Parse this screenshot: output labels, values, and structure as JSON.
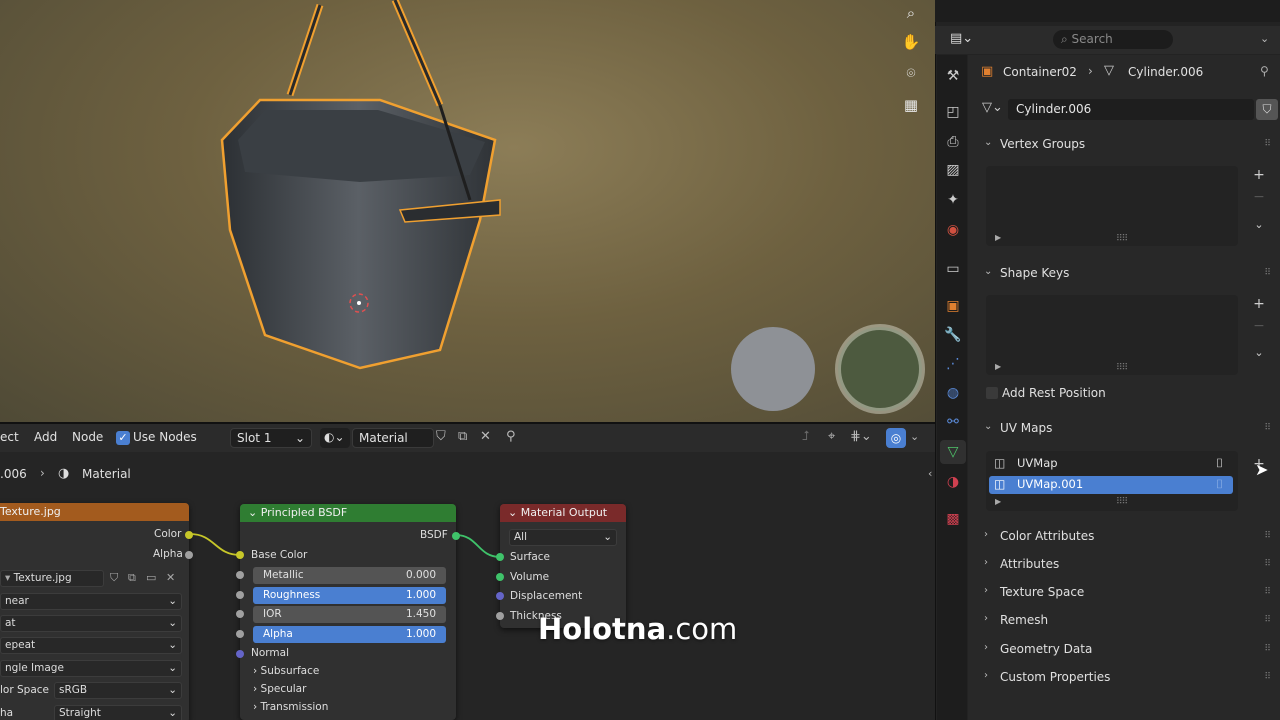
{
  "viewport": {
    "nav_icons": [
      "zoom-icon",
      "hand-pan-icon",
      "camera-icon",
      "grid-ortho-icon"
    ]
  },
  "node_header": {
    "menu_items": [
      "ect",
      "Add",
      "Node"
    ],
    "use_nodes_label": "Use Nodes",
    "use_nodes_checked": true,
    "slot": "Slot 1",
    "material_name": "Material",
    "breadcrumb_object": ".006",
    "breadcrumb_material": "Material"
  },
  "texture_node": {
    "title": "Texture.jpg",
    "outputs": [
      "Color",
      "Alpha"
    ],
    "image_name": "Texture.jpg",
    "interpolation": "near",
    "projection": "at",
    "extension": "epeat",
    "source": "ngle Image",
    "color_space_label": "lor Space",
    "color_space_value": "sRGB",
    "alpha_label": "ha",
    "alpha_value": "Straight"
  },
  "bsdf_node": {
    "title": "Principled BSDF",
    "output": "BSDF",
    "input_base_color": "Base Color",
    "fields": [
      {
        "label": "Metallic",
        "value": "0.000",
        "selected": false
      },
      {
        "label": "Roughness",
        "value": "1.000",
        "selected": true
      },
      {
        "label": "IOR",
        "value": "1.450",
        "selected": false
      },
      {
        "label": "Alpha",
        "value": "1.000",
        "selected": true
      }
    ],
    "input_normal": "Normal",
    "panels": [
      "Subsurface",
      "Specular",
      "Transmission"
    ]
  },
  "output_node": {
    "title": "Material Output",
    "target": "All",
    "inputs": [
      "Surface",
      "Volume",
      "Displacement",
      "Thickness"
    ]
  },
  "watermark": {
    "bold": "Holotna",
    "rest": ".com"
  },
  "props": {
    "search_placeholder": "Search",
    "object_name": "Container02",
    "mesh_name": "Cylinder.006",
    "mesh_datablock": "Cylinder.006",
    "sections": {
      "vertex_groups": "Vertex Groups",
      "shape_keys": "Shape Keys",
      "add_rest_position": "Add Rest Position",
      "uv_maps": "UV Maps",
      "color_attributes": "Color Attributes",
      "attributes": "Attributes",
      "texture_space": "Texture Space",
      "remesh": "Remesh",
      "geometry_data": "Geometry Data",
      "custom_properties": "Custom Properties"
    },
    "uv_maps": [
      {
        "name": "UVMap",
        "selected": false
      },
      {
        "name": "UVMap.001",
        "selected": true
      }
    ]
  },
  "colors": {
    "accent": "#4a7fd1",
    "selection_outline": "#f0a030",
    "texture_header": "#a35b1e",
    "bsdf_header": "#2f7d32",
    "output_header": "#7a2a2a"
  }
}
